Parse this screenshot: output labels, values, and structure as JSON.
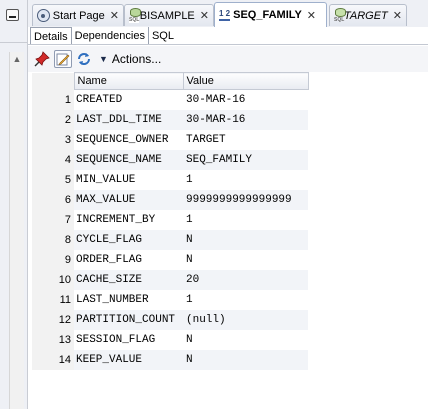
{
  "tabs": [
    {
      "label": "Start Page",
      "icon": "start-page-icon",
      "active": false,
      "italic": false
    },
    {
      "label": "BISAMPLE",
      "icon": "sql-worksheet-icon",
      "active": false,
      "italic": false
    },
    {
      "label": "SEQ_FAMILY",
      "icon": "sequence-icon",
      "active": true,
      "italic": false
    },
    {
      "label": "TARGET",
      "icon": "sql-worksheet-icon",
      "active": false,
      "italic": true
    }
  ],
  "tab_icon_text": {
    "sql": "SQL",
    "seq": "1 2"
  },
  "subtabs": [
    "Details",
    "Dependencies",
    "SQL"
  ],
  "toolbar": {
    "actions_label": "Actions..."
  },
  "grid": {
    "columns": [
      "Name",
      "Value"
    ],
    "rows": [
      {
        "n": "1",
        "name": "CREATED",
        "value": "30-MAR-16"
      },
      {
        "n": "2",
        "name": "LAST_DDL_TIME",
        "value": "30-MAR-16"
      },
      {
        "n": "3",
        "name": "SEQUENCE_OWNER",
        "value": "TARGET"
      },
      {
        "n": "4",
        "name": "SEQUENCE_NAME",
        "value": "SEQ_FAMILY"
      },
      {
        "n": "5",
        "name": "MIN_VALUE",
        "value": "1"
      },
      {
        "n": "6",
        "name": "MAX_VALUE",
        "value": "9999999999999999"
      },
      {
        "n": "7",
        "name": "INCREMENT_BY",
        "value": "1"
      },
      {
        "n": "8",
        "name": "CYCLE_FLAG",
        "value": "N"
      },
      {
        "n": "9",
        "name": "ORDER_FLAG",
        "value": "N"
      },
      {
        "n": "10",
        "name": "CACHE_SIZE",
        "value": "20"
      },
      {
        "n": "11",
        "name": "LAST_NUMBER",
        "value": "1"
      },
      {
        "n": "12",
        "name": "PARTITION_COUNT",
        "value": "(null)"
      },
      {
        "n": "13",
        "name": "SESSION_FLAG",
        "value": "N"
      },
      {
        "n": "14",
        "name": "KEEP_VALUE",
        "value": "N"
      }
    ]
  }
}
